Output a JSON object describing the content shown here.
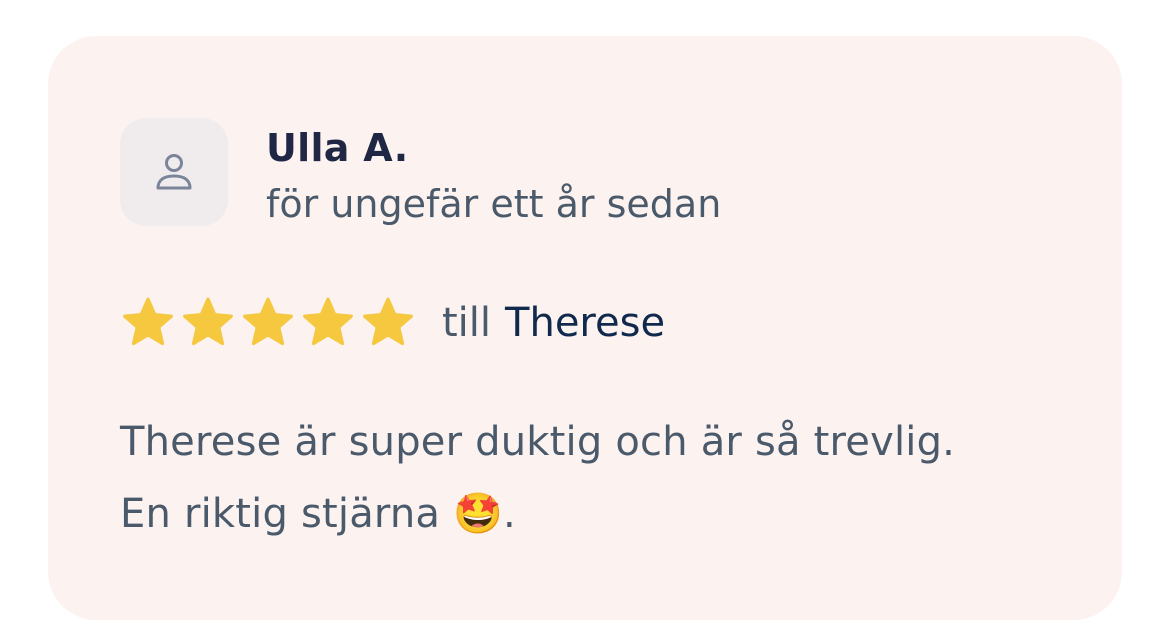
{
  "review": {
    "author_name": "Ulla A.",
    "time_ago": "för ungefär ett år sedan",
    "rating": 5,
    "rating_max": 5,
    "to_prefix": "till",
    "recipient": "Therese",
    "body_line1": "Therese är super duktig och är så trevlig.",
    "body_line2": "En riktig stjärna 🤩."
  },
  "icons": {
    "avatar": "user-icon",
    "star": "star-icon"
  },
  "colors": {
    "card_background": "#fcf3f1",
    "star": "#f6c83f",
    "name": "#1f2744",
    "recipient": "#11294d",
    "muted_text": "#4b5a6b"
  }
}
